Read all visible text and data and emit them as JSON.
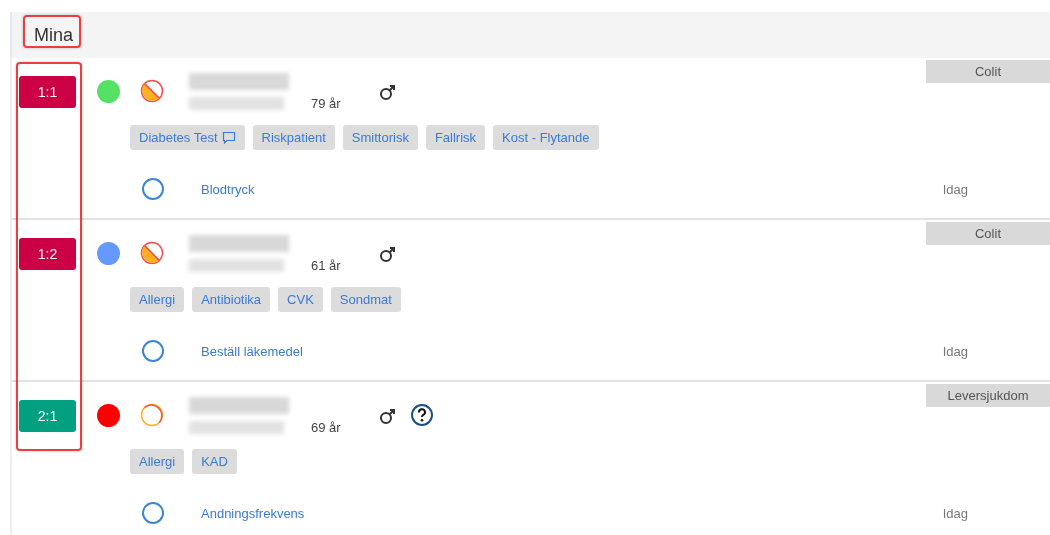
{
  "header": {
    "title": "Mina",
    "framed": true
  },
  "badges_framed": true,
  "patients": [
    {
      "bed": {
        "label": "1:1",
        "color": "#cc0044"
      },
      "status": {
        "color": "#55e066"
      },
      "risk": {
        "kind": "partial"
      },
      "age": "79 år",
      "gender": {
        "kind": "male"
      },
      "unknown": false,
      "diagnosis": "Colit",
      "tags": [
        {
          "label": "Diabetes Test",
          "comment": true
        },
        {
          "label": "Riskpatient",
          "comment": false
        },
        {
          "label": "Smittorisk",
          "comment": false
        },
        {
          "label": "Fallrisk",
          "comment": false
        },
        {
          "label": "Kost - Flytande",
          "comment": false
        }
      ],
      "task": {
        "label": "Blodtryck",
        "when": "Idag"
      }
    },
    {
      "bed": {
        "label": "1:2",
        "color": "#cc0044"
      },
      "status": {
        "color": "#6699ff"
      },
      "risk": {
        "kind": "partial"
      },
      "age": "61 år",
      "gender": {
        "kind": "male"
      },
      "unknown": false,
      "diagnosis": "Colit",
      "tags": [
        {
          "label": "Allergi",
          "comment": false
        },
        {
          "label": "Antibiotika",
          "comment": false
        },
        {
          "label": "CVK",
          "comment": false
        },
        {
          "label": "Sondmat",
          "comment": false
        }
      ],
      "task": {
        "label": "Beställ läkemedel",
        "when": "Idag"
      }
    },
    {
      "bed": {
        "label": "2:1",
        "color": "#00a080"
      },
      "status": {
        "color": "#ff0000"
      },
      "risk": {
        "kind": "none"
      },
      "age": "69 år",
      "gender": {
        "kind": "male"
      },
      "unknown": true,
      "diagnosis": "Leversjukdom",
      "tags": [
        {
          "label": "Allergi",
          "comment": false
        },
        {
          "label": "KAD",
          "comment": false
        }
      ],
      "task": {
        "label": "Andningsfrekvens",
        "when": "Idag"
      }
    }
  ]
}
